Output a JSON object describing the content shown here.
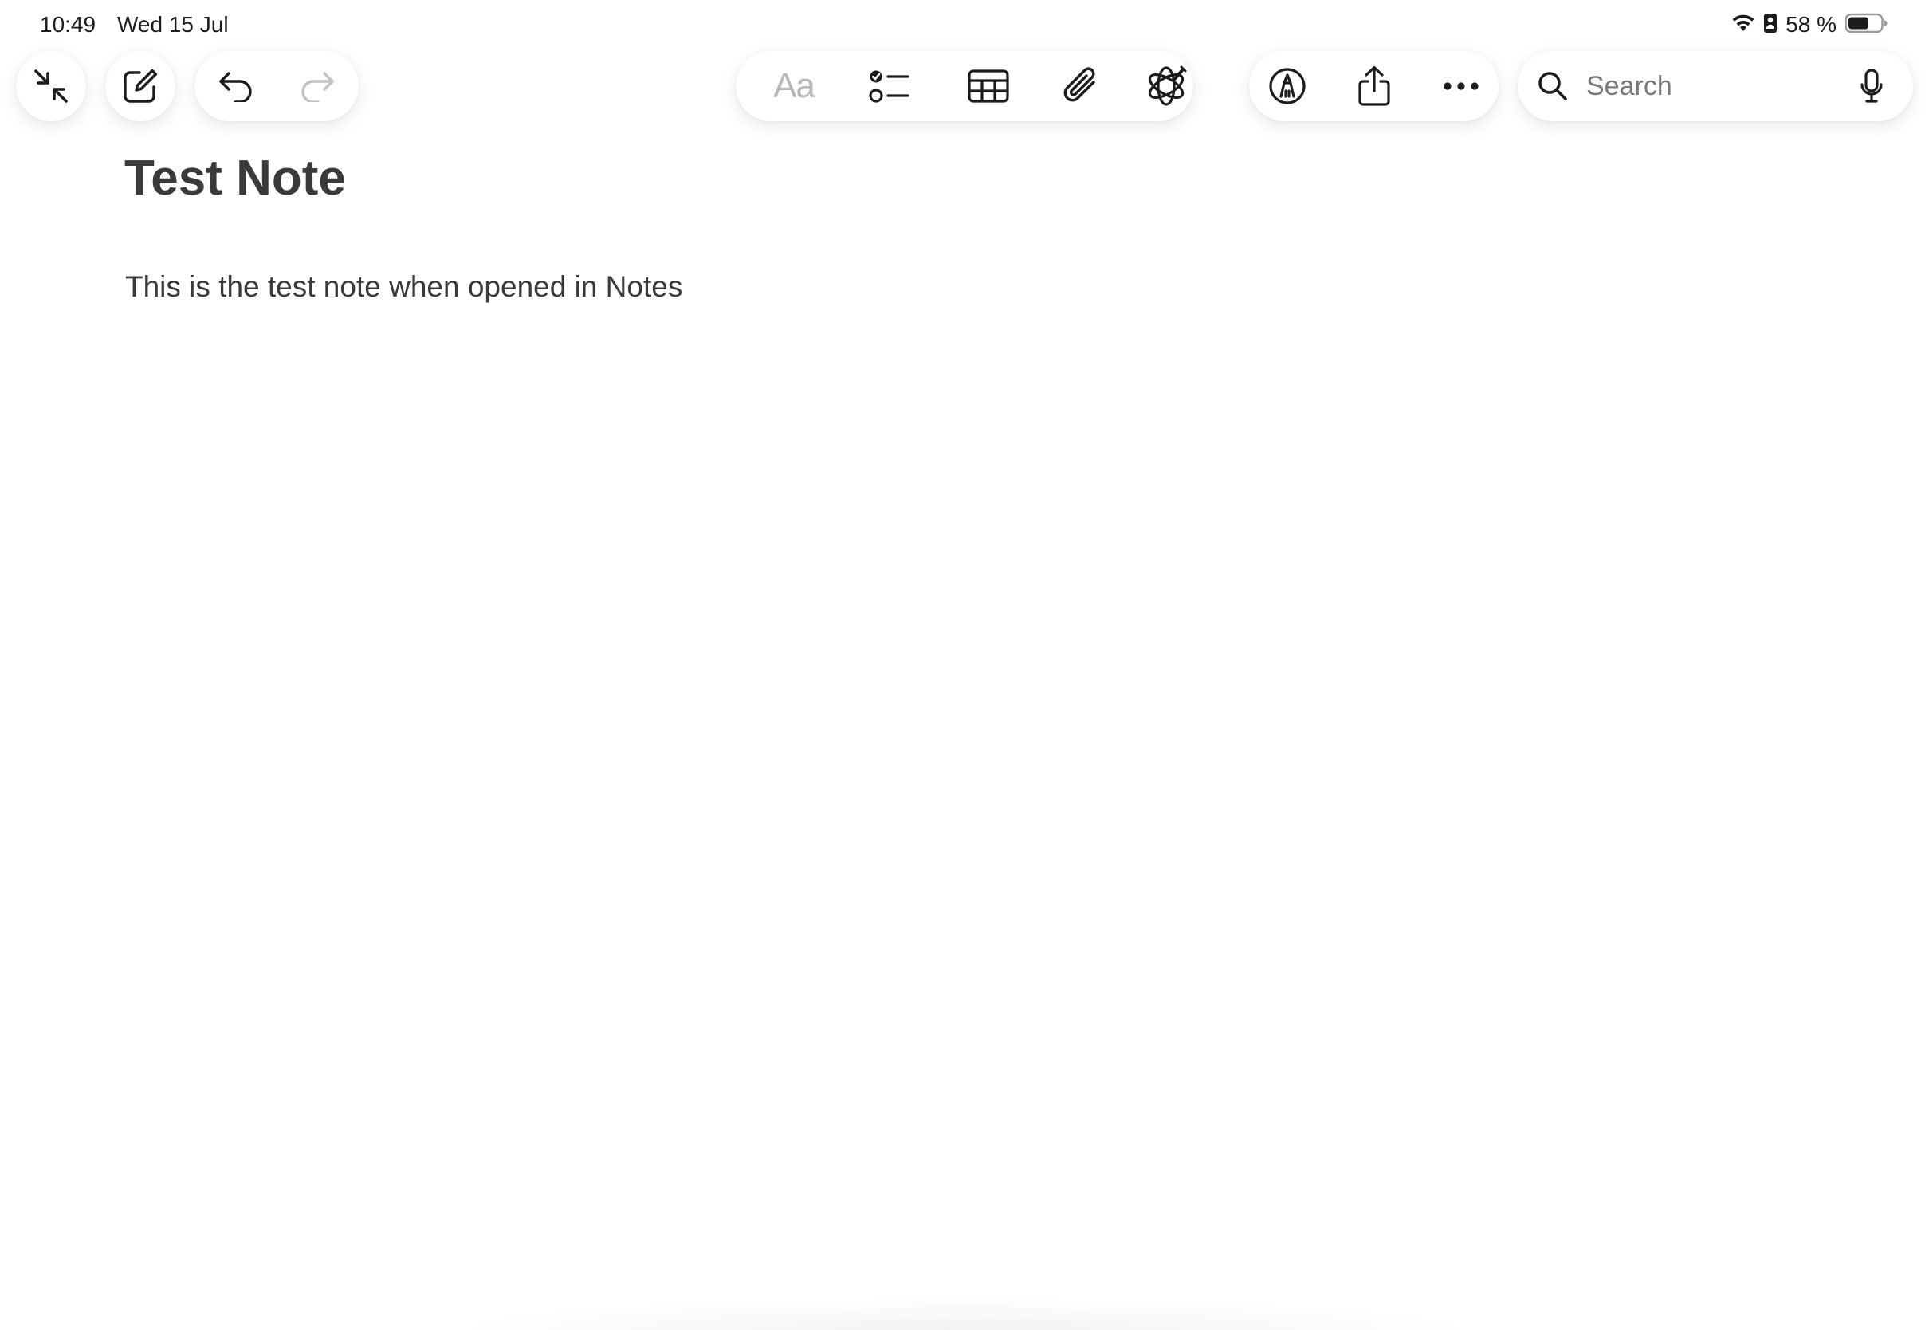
{
  "status_bar": {
    "time": "10:49",
    "date": "Wed 15 Jul",
    "battery_percent": "58 %",
    "icons": [
      "wifi-icon",
      "orientation-lock-icon",
      "battery-icon"
    ]
  },
  "toolbar": {
    "left": [
      "collapse-icon",
      "compose-icon",
      "undo-icon",
      "redo-icon"
    ],
    "format_label": "Aa",
    "center": [
      "checklist-icon",
      "table-icon",
      "attachment-icon",
      "writing-tools-icon"
    ],
    "right": [
      "markup-icon",
      "share-icon",
      "more-icon"
    ],
    "redo_enabled": false
  },
  "search": {
    "placeholder": "Search",
    "icons": [
      "search-icon",
      "microphone-icon"
    ]
  },
  "note": {
    "title": "Test Note",
    "body": "This is the test note when opened in Notes"
  },
  "colors": {
    "text": "#3a3a3c",
    "icon": "#1c1c1e",
    "disabled": "#b7b7bb",
    "background": "#ffffff"
  }
}
